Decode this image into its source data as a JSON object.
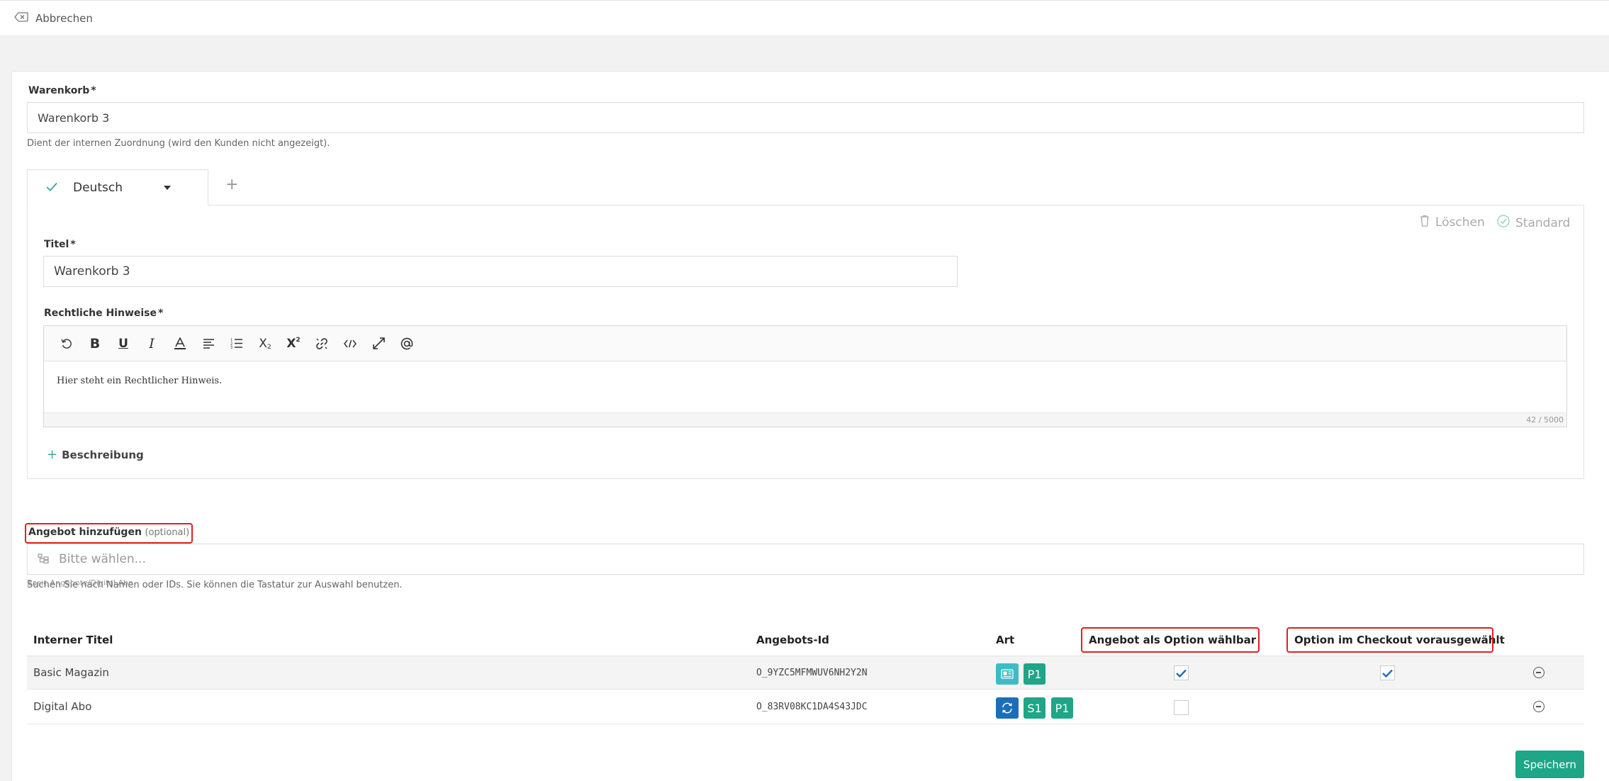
{
  "topbar": {
    "cancel_label": "Abbrechen"
  },
  "basket": {
    "label": "Warenkorb",
    "required_mark": "*",
    "value": "Warenkorb 3",
    "help": "Dient der internen Zuordnung (wird den Kunden nicht angezeigt)."
  },
  "language_tab": {
    "label": "Deutsch"
  },
  "language_actions": {
    "delete_label": "Löschen",
    "default_label": "Standard"
  },
  "title_field": {
    "label": "Titel",
    "required_mark": "*",
    "value": "Warenkorb 3"
  },
  "legal": {
    "label": "Rechtliche Hinweise",
    "required_mark": "*",
    "text": "Hier steht ein Rechtlicher Hinweis.",
    "counter": "42 / 5000"
  },
  "toolbar_icons": [
    "undo-icon",
    "bold-icon",
    "underline-icon",
    "italic-icon",
    "font-color-icon",
    "align-icon",
    "ordered-list-icon",
    "subscript-icon",
    "superscript-icon",
    "link-icon",
    "code-icon",
    "fullscreen-icon",
    "mention-icon"
  ],
  "add_description_label": "Beschreibung",
  "offer": {
    "label": "Angebot hinzufügen",
    "optional": "(optional)",
    "placeholder": "Bitte wählen...",
    "help": "Suchen Sie nach Namen oder IDs. Sie können die Tastatur zur Auswahl benutzen.",
    "overlap_text": "Basic Angebote/Digital Abo"
  },
  "table": {
    "headers": {
      "title": "Interner Titel",
      "id": "Angebots-Id",
      "type": "Art",
      "selectable": "Angebot als Option wählbar",
      "preselected": "Option im Checkout vorausgewählt"
    },
    "rows": [
      {
        "title": "Basic Magazin",
        "id": "O_9YZC5MFMWUV6NH2Y2N",
        "badges": [
          "P1"
        ],
        "selectable": true,
        "preselected": true
      },
      {
        "title": "Digital Abo",
        "id": "O_83RV08KC1DA4S43JDC",
        "badges": [
          "S1",
          "P1"
        ],
        "selectable": false,
        "preselected": false
      }
    ]
  },
  "save_label": "Speichern",
  "colors": {
    "accent": "#1fa587",
    "badge_teal": "#1fa587",
    "badge_light": "#3cbcc4",
    "badge_blue": "#1b6fb8",
    "highlight": "#e02020"
  }
}
